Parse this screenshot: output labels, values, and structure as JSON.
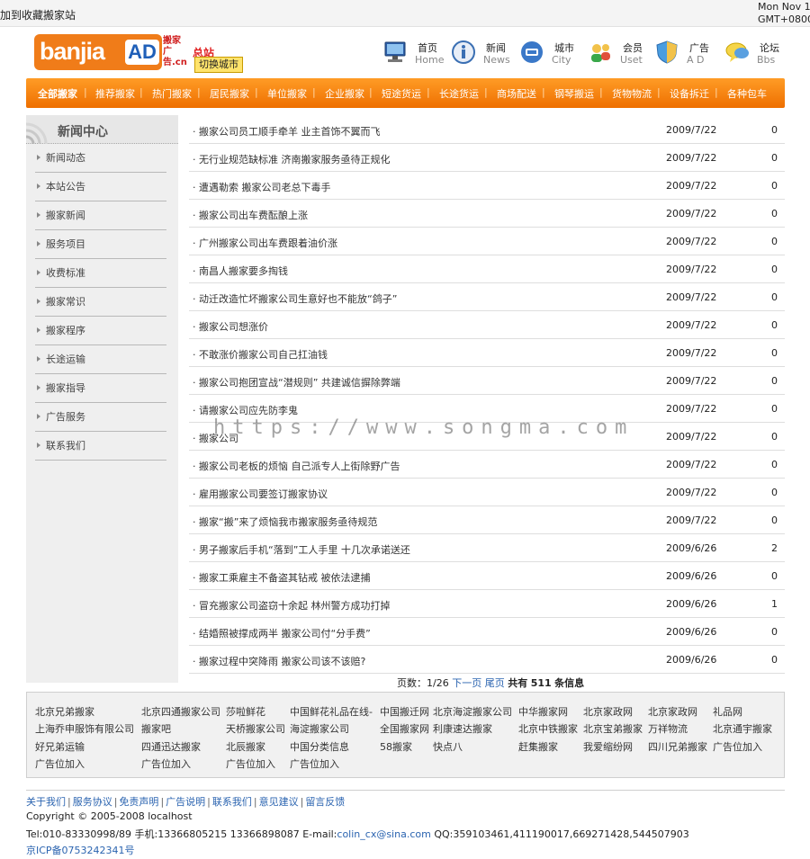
{
  "topbar": {
    "favorite": "加到收藏搬家站",
    "clock_line1": "Mon Nov 1",
    "clock_line2": "GMT+0800"
  },
  "logo": {
    "word": "banjia",
    "ad": "AD",
    "side_text": "搬家广告.cn",
    "zong": "总站",
    "switch_city": "切换城市"
  },
  "topnav": [
    {
      "label": "首页",
      "sub": "Home",
      "icon": "monitor-icon"
    },
    {
      "label": "新闻",
      "sub": "News",
      "icon": "info-icon"
    },
    {
      "label": "城市",
      "sub": "City",
      "icon": "city-icon"
    },
    {
      "label": "会员",
      "sub": "Uset",
      "icon": "users-icon"
    },
    {
      "label": "广告",
      "sub": "A D",
      "icon": "shield-icon"
    },
    {
      "label": "论坛",
      "sub": "Bbs",
      "icon": "chat-icon"
    }
  ],
  "categories": [
    "全部搬家",
    "推荐搬家",
    "热门搬家",
    "居民搬家",
    "单位搬家",
    "企业搬家",
    "短途货运",
    "长途货运",
    "商场配送",
    "钢琴搬运",
    "货物物流",
    "设备拆迁",
    "各种包车"
  ],
  "sidebar": {
    "title": "新闻中心",
    "items": [
      "新闻动态",
      "本站公告",
      "搬家新闻",
      "服务项目",
      "收费标准",
      "搬家常识",
      "搬家程序",
      "长途运输",
      "搬家指导",
      "广告服务",
      "联系我们"
    ]
  },
  "news": [
    {
      "title": "· 搬家公司员工顺手牵羊 业主首饰不翼而飞",
      "date": "2009/7/22",
      "hits": "0"
    },
    {
      "title": "· 无行业规范缺标准 济南搬家服务亟待正规化",
      "date": "2009/7/22",
      "hits": "0"
    },
    {
      "title": "· 遭遇勒索 搬家公司老总下毒手",
      "date": "2009/7/22",
      "hits": "0"
    },
    {
      "title": "· 搬家公司出车费酝酿上涨",
      "date": "2009/7/22",
      "hits": "0"
    },
    {
      "title": "· 广州搬家公司出车费跟着油价涨",
      "date": "2009/7/22",
      "hits": "0"
    },
    {
      "title": "· 南昌人搬家要多掏钱",
      "date": "2009/7/22",
      "hits": "0"
    },
    {
      "title": "· 动迁改造忙坏搬家公司生意好也不能放“鸽子”",
      "date": "2009/7/22",
      "hits": "0"
    },
    {
      "title": "· 搬家公司想涨价",
      "date": "2009/7/22",
      "hits": "0"
    },
    {
      "title": "· 不敢涨价搬家公司自己扛油钱",
      "date": "2009/7/22",
      "hits": "0"
    },
    {
      "title": "· 搬家公司抱团宣战“潜规则” 共建诚信摒除弊端",
      "date": "2009/7/22",
      "hits": "0"
    },
    {
      "title": "· 请搬家公司应先防李鬼",
      "date": "2009/7/22",
      "hits": "0"
    },
    {
      "title": "· 搬家公司",
      "date": "2009/7/22",
      "hits": "0"
    },
    {
      "title": "· 搬家公司老板的烦恼 自己派专人上街除野广告",
      "date": "2009/7/22",
      "hits": "0"
    },
    {
      "title": "· 雇用搬家公司要签订搬家协议",
      "date": "2009/7/22",
      "hits": "0"
    },
    {
      "title": "· 搬家“搬”来了烦恼我市搬家服务亟待规范",
      "date": "2009/7/22",
      "hits": "0"
    },
    {
      "title": "· 男子搬家后手机“落到”工人手里 十几次承诺送还",
      "date": "2009/6/26",
      "hits": "2"
    },
    {
      "title": "· 搬家工乘雇主不备盗其钻戒 被依法逮捕",
      "date": "2009/6/26",
      "hits": "0"
    },
    {
      "title": "· 冒充搬家公司盗窃十余起 林州警方成功打掉",
      "date": "2009/6/26",
      "hits": "1"
    },
    {
      "title": "· 结婚照被撑成两半 搬家公司付“分手费”",
      "date": "2009/6/26",
      "hits": "0"
    },
    {
      "title": "· 搬家过程中突降雨 搬家公司该不该赔?",
      "date": "2009/6/26",
      "hits": "0"
    }
  ],
  "pager": {
    "prefix": "页数：1/26",
    "next": "下一页",
    "last": "尾页",
    "total_prefix": "共有",
    "total": "511",
    "total_suffix": "条信息"
  },
  "watermark": "https://www.songma.com",
  "friend_links": [
    [
      "北京兄弟搬家",
      "北京四通搬家公司",
      "莎啦鲜花",
      "中国鲜花礼品在线-",
      "中国搬迁网",
      "北京海淀搬家公司",
      "中华搬家网",
      "北京家政网",
      "北京家政网",
      "礼品网"
    ],
    [
      "上海乔申服饰有限公司",
      "搬家吧",
      "天桥搬家公司",
      "海淀搬家公司",
      "全国搬家网",
      "利康速达搬家",
      "北京中铁搬家",
      "北京宝弟搬家",
      "万祥物流",
      "北京通宇搬家"
    ],
    [
      "好兄弟运输",
      "四通迅达搬家",
      "北辰搬家",
      "中国分类信息",
      "58搬家",
      "快点八",
      "赶集搬家",
      "我爱缩纷网",
      "四川兄弟搬家",
      "广告位加入"
    ],
    [
      "广告位加入",
      "广告位加入",
      "广告位加入",
      "广告位加入"
    ]
  ],
  "footer": {
    "nav": [
      "关于我们",
      "服务协议",
      "免责声明",
      "广告说明",
      "联系我们",
      "意见建议",
      "留言反馈"
    ],
    "copyright": "Copyright © 2005-2008 localhost",
    "contact_prefix": "Tel:010-83330998/89 手机:13366805215 13366898087 E-mail:",
    "email": "colin_cx@sina.com",
    "contact_suffix": " QQ:359103461,411190017,669271428,544507903",
    "icp": "京ICP备07532423​41号"
  },
  "colors": {
    "accent": "#f07c19",
    "nav_bar": "#ee6f00",
    "link": "#2b64b0"
  }
}
